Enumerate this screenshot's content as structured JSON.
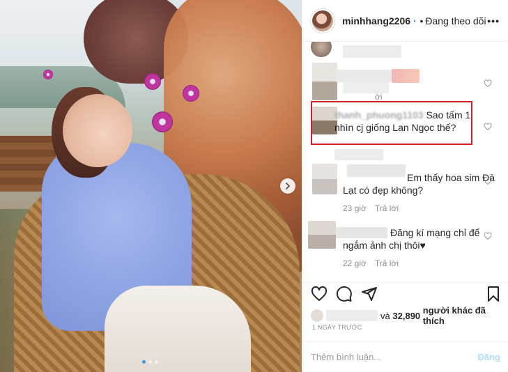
{
  "header": {
    "username": "minhhang2206",
    "separator": "•",
    "follow_status": "Đang theo dõi",
    "more_label": "•••"
  },
  "photo": {
    "carousel_dots": 3,
    "active_dot": 0
  },
  "comments": [
    {
      "username": "",
      "text": "",
      "time": "",
      "reply": ""
    },
    {
      "username": "",
      "text": "",
      "time": "",
      "reply": "ời"
    },
    {
      "username": "thanh_phuong1103",
      "text": "Sao tấm 1 nhìn cj giống Lan Ngọc thế?",
      "time": "",
      "reply": ""
    },
    {
      "username": "",
      "text": "Em thấy hoa sim Đà Lạt có đẹp không?",
      "time": "23 giờ",
      "reply": "Trả lời"
    },
    {
      "username": "",
      "text": "Đăng kí mạng chỉ để ngắm ảnh chị thôi♥",
      "time": "22 giờ",
      "reply": "Trả lời"
    }
  ],
  "likes": {
    "prefix": "và",
    "count": "32,890",
    "suffix": "người khác đã thích"
  },
  "post_time": "1 NGÀY TRƯỚC",
  "add_comment": {
    "placeholder": "Thêm bình luận...",
    "post_label": "Đăng"
  },
  "icons": {
    "like": "heart-icon",
    "comment": "comment-icon",
    "share": "share-icon",
    "save": "bookmark-icon",
    "next": "chevron-right-icon"
  },
  "colors": {
    "highlight_border": "#d3222a",
    "link_blue": "#3897f0",
    "muted": "#8e8e8e",
    "post_button": "#b3dbff"
  }
}
